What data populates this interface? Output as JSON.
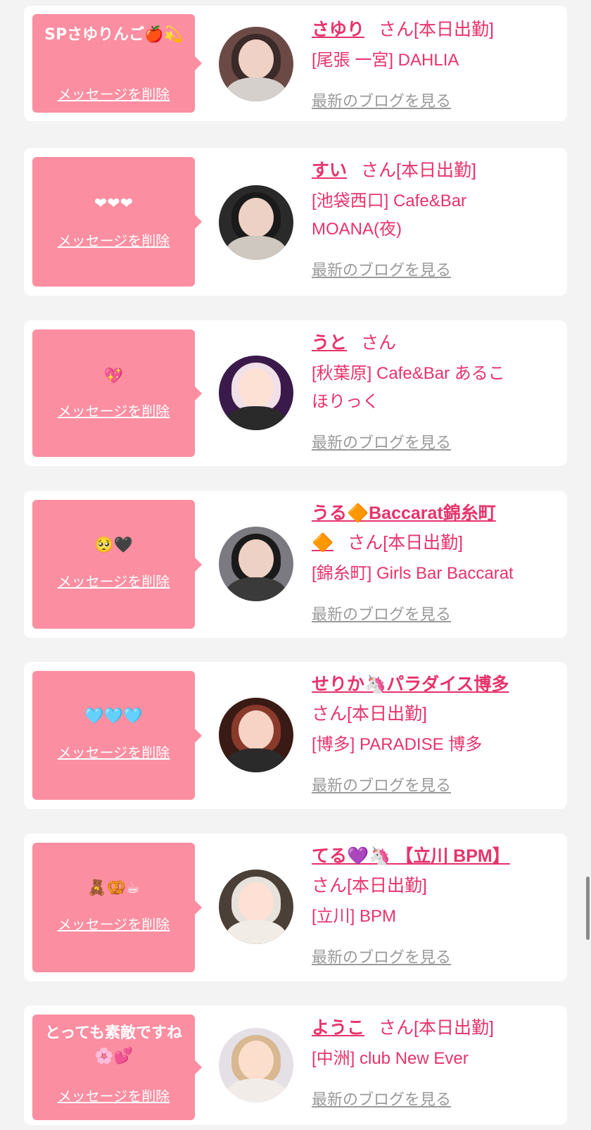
{
  "delete_label": "メッセージを削除",
  "blog_label": "最新のブログを見る",
  "cards": [
    {
      "message": "SPさゆりんご🍎💫",
      "name": "さゆり",
      "suffix": "さん[本日出勤]",
      "store_lines": [
        "[尾張 一宮] DAHLIA"
      ],
      "avatar_colors": [
        "#6b4a46",
        "#3a2a28",
        "#d6d0cc"
      ]
    },
    {
      "message": "❤❤❤",
      "name": "すい",
      "suffix": "さん[本日出勤]",
      "store_lines": [
        "[池袋西口] Cafe&Bar",
        "MOANA(夜)"
      ],
      "avatar_colors": [
        "#2a2a2a",
        "#1a1a1a",
        "#cfc8c0"
      ]
    },
    {
      "message": "💖",
      "name": "うと",
      "suffix": "さん",
      "store_lines": [
        "[秋葉原] Cafe&Bar あるこ",
        "ほりっく"
      ],
      "avatar_colors": [
        "#3a1a4a",
        "#f0e0e8",
        "#2a2a2a"
      ]
    },
    {
      "message": "🥺🖤",
      "name": "うる🔶Baccarat錦糸町",
      "name_extra": "🔶",
      "suffix": "さん[本日出勤]",
      "store_lines": [
        "[錦糸町] Girls Bar Baccarat"
      ],
      "avatar_colors": [
        "#7a7a80",
        "#1a1a1a",
        "#3a3a3a"
      ]
    },
    {
      "message": "🩵🩵🩵",
      "name": "せりか🦄パラダイス博多",
      "suffix": "さん[本日出勤]",
      "store_lines": [
        "[博多] PARADISE 博多"
      ],
      "avatar_colors": [
        "#3a1a14",
        "#8a3a2a",
        "#2a2a2a"
      ]
    },
    {
      "message": "🧸🥨☕",
      "name": "てる💜🦄 【立川 BPM】",
      "suffix": "さん[本日出勤]",
      "store_lines": [
        "[立川] BPM"
      ],
      "avatar_colors": [
        "#4a4038",
        "#e8e2dc",
        "#f2ece6"
      ]
    },
    {
      "message": "とっても素敵ですね🌸💕",
      "name": "ようこ",
      "suffix": "さん[本日出勤]",
      "store_lines": [
        "[中洲] club New Ever"
      ],
      "avatar_colors": [
        "#e4e0e6",
        "#d8b890",
        "#f2ece8"
      ]
    }
  ]
}
